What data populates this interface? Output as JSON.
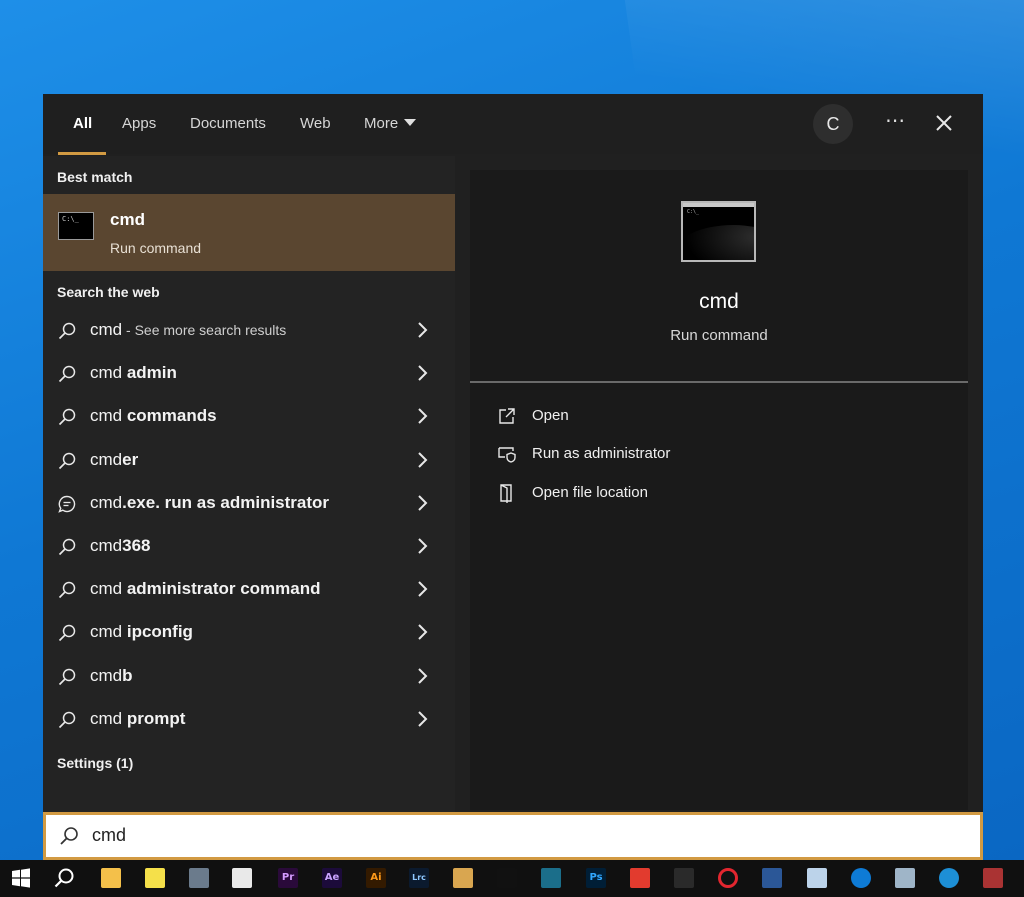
{
  "tabs": [
    {
      "label": "All"
    },
    {
      "label": "Apps"
    },
    {
      "label": "Documents"
    },
    {
      "label": "Web"
    },
    {
      "label": "More"
    }
  ],
  "account": {
    "initial": "C"
  },
  "sections": {
    "best_match": "Best match",
    "search_web": "Search the web",
    "settings": "Settings (1)"
  },
  "best_match": {
    "title": "cmd",
    "subtitle": "Run command",
    "icon_prompt": "C:\\_"
  },
  "web_results": [
    {
      "prefix": "cmd",
      "bold": "",
      "suffix": " - See more search results",
      "icon": "search-icon"
    },
    {
      "prefix": "cmd ",
      "bold": "admin",
      "suffix": "",
      "icon": "search-icon"
    },
    {
      "prefix": "cmd ",
      "bold": "commands",
      "suffix": "",
      "icon": "search-icon"
    },
    {
      "prefix": "cmd",
      "bold": "er",
      "suffix": "",
      "icon": "search-icon"
    },
    {
      "prefix": "cmd",
      "bold": ".exe. run as administrator",
      "suffix": "",
      "icon": "chat-bubble-icon"
    },
    {
      "prefix": "cmd",
      "bold": "368",
      "suffix": "",
      "icon": "search-icon"
    },
    {
      "prefix": "cmd ",
      "bold": "administrator command",
      "suffix": "",
      "icon": "search-icon"
    },
    {
      "prefix": "cmd ",
      "bold": "ipconfig",
      "suffix": "",
      "icon": "search-icon"
    },
    {
      "prefix": "cmd",
      "bold": "b",
      "suffix": "",
      "icon": "search-icon"
    },
    {
      "prefix": "cmd ",
      "bold": "prompt",
      "suffix": "",
      "icon": "search-icon"
    }
  ],
  "preview": {
    "title": "cmd",
    "subtitle": "Run command"
  },
  "actions": [
    {
      "label": "Open",
      "icon": "open-icon"
    },
    {
      "label": "Run as administrator",
      "icon": "shield-icon"
    },
    {
      "label": "Open file location",
      "icon": "folder-location-icon"
    }
  ],
  "search": {
    "value": "cmd"
  },
  "taskbar": {
    "apps": [
      {
        "name": "file-explorer",
        "text": ""
      },
      {
        "name": "sticky-notes",
        "text": ""
      },
      {
        "name": "calculator",
        "text": ""
      },
      {
        "name": "snip-tool",
        "text": ""
      },
      {
        "name": "premiere-pro",
        "text": "Pr"
      },
      {
        "name": "after-effects",
        "text": "Ae"
      },
      {
        "name": "illustrator",
        "text": "Ai"
      },
      {
        "name": "lightroom-classic",
        "text": "Lrc"
      },
      {
        "name": "media-player",
        "text": ""
      },
      {
        "name": "tiktok",
        "text": ""
      },
      {
        "name": "app-panel",
        "text": ""
      },
      {
        "name": "photoshop",
        "text": "Ps"
      },
      {
        "name": "colorful-app",
        "text": ""
      },
      {
        "name": "recorder",
        "text": ""
      },
      {
        "name": "opera",
        "text": ""
      },
      {
        "name": "word",
        "text": ""
      },
      {
        "name": "notepad",
        "text": ""
      },
      {
        "name": "edge",
        "text": ""
      },
      {
        "name": "remote-desktop",
        "text": ""
      },
      {
        "name": "blue-app",
        "text": ""
      },
      {
        "name": "game-app",
        "text": ""
      }
    ],
    "colors": {
      "accent": "#d29a42",
      "selected": "#5a4630"
    }
  }
}
